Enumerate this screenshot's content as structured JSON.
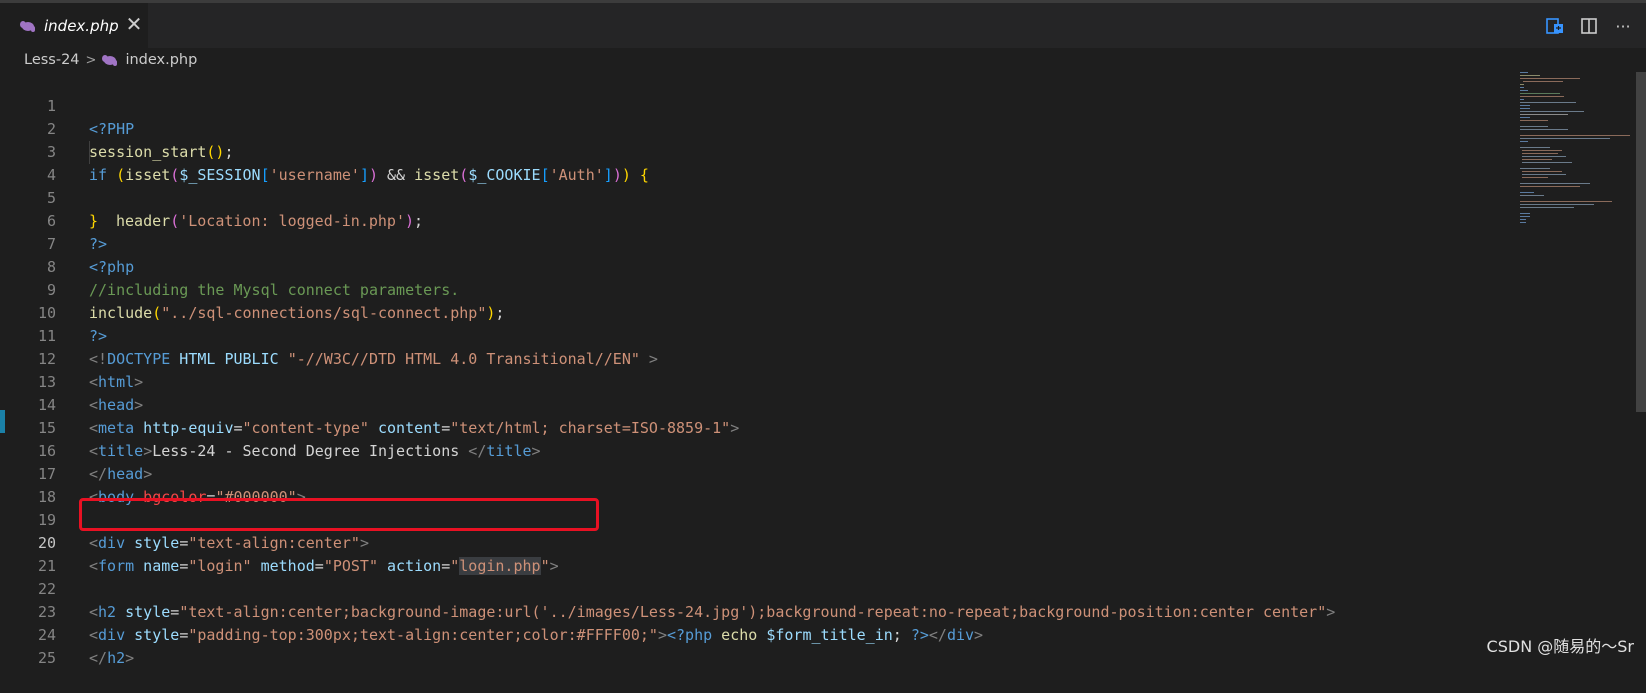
{
  "tab": {
    "title": "index.php",
    "icon": "php-elephant-icon",
    "close_label": "✕"
  },
  "actions": [
    {
      "name": "open-changes-icon"
    },
    {
      "name": "split-editor-icon"
    },
    {
      "name": "more-actions-icon",
      "label": "···"
    }
  ],
  "breadcrumb": {
    "folder": "Less-24",
    "separator": ">",
    "file": "index.php"
  },
  "active_line": 20,
  "lines": [
    {
      "n": "1"
    },
    {
      "n": "2"
    },
    {
      "n": "3"
    },
    {
      "n": "4"
    },
    {
      "n": "5"
    },
    {
      "n": "6"
    },
    {
      "n": "7"
    },
    {
      "n": "8"
    },
    {
      "n": "9"
    },
    {
      "n": "10"
    },
    {
      "n": "11"
    },
    {
      "n": "12"
    },
    {
      "n": "13"
    },
    {
      "n": "14"
    },
    {
      "n": "15"
    },
    {
      "n": "16"
    },
    {
      "n": "17"
    },
    {
      "n": "18"
    },
    {
      "n": "19"
    },
    {
      "n": "20"
    },
    {
      "n": "21"
    },
    {
      "n": "22"
    },
    {
      "n": "23"
    },
    {
      "n": "24"
    },
    {
      "n": "25"
    }
  ],
  "code": {
    "l1_open": "<?PHP",
    "l2_fn": "session_start",
    "l2_paren": "()",
    "l2_semi": ";",
    "l3_if": "if",
    "l3_p1": "(",
    "l3_isset1": "isset",
    "l3_p2": "(",
    "l3_v1": "$_SESSION",
    "l3_b1": "[",
    "l3_s1": "'username'",
    "l3_b2": "]",
    "l3_p3": ")",
    "l3_and": " && ",
    "l3_isset2": "isset",
    "l3_p4": "(",
    "l3_v2": "$_COOKIE",
    "l3_b3": "[",
    "l3_s2": "'Auth'",
    "l3_b4": "]",
    "l3_p5": ")",
    "l3_p6": ")",
    "l3_brace": " {",
    "l4_fn": "header",
    "l4_p1": "(",
    "l4_s": "'Location: logged-in.php'",
    "l4_p2": ")",
    "l4_semi": ";",
    "l5_brace": "}",
    "l6_close": "?>",
    "l7_open": "<?php",
    "l8_comment": "//including the Mysql connect parameters.",
    "l9_fn": "include",
    "l9_p1": "(",
    "l9_s": "\"../sql-connections/sql-connect.php\"",
    "l9_p2": ")",
    "l9_semi": ";",
    "l10_close": "?>",
    "l11_lt": "<!",
    "l11_doctype": "DOCTYPE",
    "l11_html": " HTML PUBLIC ",
    "l11_s": "\"-//W3C//DTD HTML 4.0 Transitional//EN\"",
    "l11_gt": " >",
    "l12_lt": "<",
    "l12_tag": "html",
    "l12_gt": ">",
    "l13_lt": "<",
    "l13_tag": "head",
    "l13_gt": ">",
    "l14_lt": "<",
    "l14_tag": "meta",
    "l14_a1": " http-equiv",
    "l14_eq1": "=",
    "l14_v1": "\"content-type\"",
    "l14_a2": " content",
    "l14_eq2": "=",
    "l14_v2": "\"text/html; charset=ISO-8859-1\"",
    "l14_gt": ">",
    "l15_lt": "<",
    "l15_tag": "title",
    "l15_gt": ">",
    "l15_text": "Less-24 - Second Degree Injections ",
    "l15_lt2": "</",
    "l15_tag2": "title",
    "l15_gt2": ">",
    "l16_lt": "</",
    "l16_tag": "head",
    "l16_gt": ">",
    "l17_lt": "<",
    "l17_tag": "body",
    "l17_a": " bgcolor",
    "l17_eq": "=",
    "l17_v": "\"#000000\"",
    "l17_gt": ">",
    "l19_lt": "<",
    "l19_tag": "div",
    "l19_a": " style",
    "l19_eq": "=",
    "l19_v": "\"text-align:center\"",
    "l19_gt": ">",
    "l20_lt": "<",
    "l20_tag": "form",
    "l20_a1": " name",
    "l20_eq1": "=",
    "l20_v1": "\"login\"",
    "l20_a2": " method",
    "l20_eq2": "=",
    "l20_v2": "\"POST\"",
    "l20_a3": " action",
    "l20_eq3": "=",
    "l20_q1": "\"",
    "l20_v3": "login.php",
    "l20_q2": "\"",
    "l20_gt": ">",
    "l22_lt": "<",
    "l22_tag": "h2",
    "l22_a": " style",
    "l22_eq": "=",
    "l22_v": "\"text-align:center;background-image:url('../images/Less-24.jpg');background-repeat:no-repeat;background-position:center center\"",
    "l22_gt": ">",
    "l23_lt": "<",
    "l23_tag": "div",
    "l23_a": " style",
    "l23_eq": "=",
    "l23_v": "\"padding-top:300px;text-align:center;color:#FFFF00;\"",
    "l23_gt": ">",
    "l23_php": "<?php",
    "l23_echo": " echo ",
    "l23_var": "$form_title_in",
    "l23_semi": "; ",
    "l23_close": "?>",
    "l23_lt2": "</",
    "l23_tag2": "div",
    "l23_gt2": ">",
    "l24_lt": "</",
    "l24_tag": "h2",
    "l24_gt": ">"
  },
  "watermark": "CSDN @随易的～Sr",
  "colors": {
    "editor_bg": "#1e1e1e",
    "highlight_box": "#e81123",
    "line_modified_marker": "#1b81a8"
  }
}
